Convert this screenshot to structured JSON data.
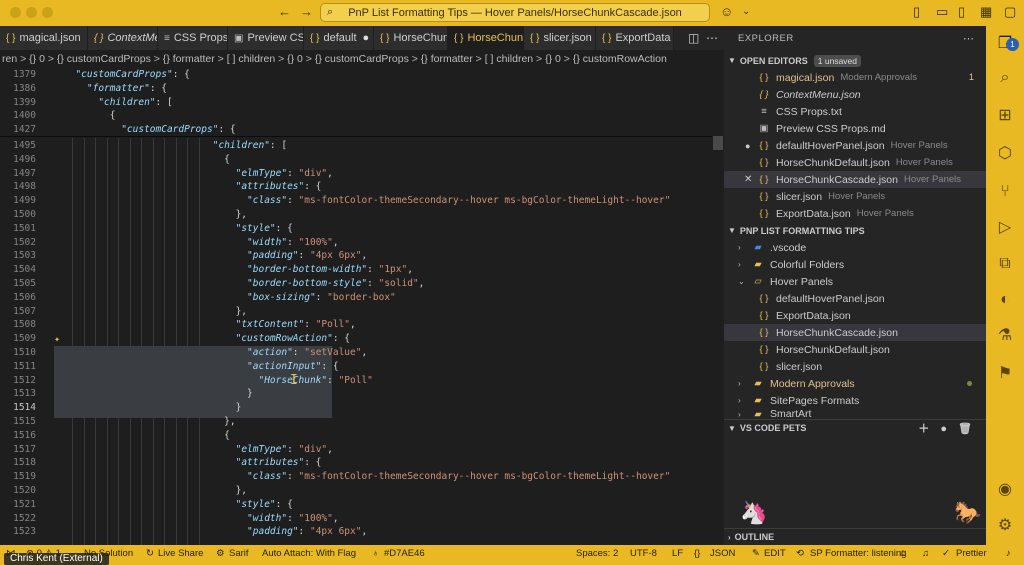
{
  "window": {
    "title": "PnP List Formatting Tips — Hover Panels/HorseChunkCascade.json"
  },
  "tabs": [
    {
      "label": "magical.json",
      "icon": "json-icon"
    },
    {
      "label": "ContextMe",
      "icon": "json-icon"
    },
    {
      "label": "CSS Props.",
      "icon": "text-icon"
    },
    {
      "label": "Preview CS",
      "icon": "preview-icon"
    },
    {
      "label": "default",
      "icon": "json-icon"
    },
    {
      "label": "HorseChun",
      "icon": "json-icon"
    },
    {
      "label": "HorseChun",
      "icon": "json-icon"
    },
    {
      "label": "slicer.json",
      "icon": "json-icon"
    },
    {
      "label": "ExportData",
      "icon": "json-icon"
    }
  ],
  "breadcrumb": "ren > {} 0 > {} customCardProps > {} formatter > [ ] children > {} 0 > {} customCardProps > {} formatter > [ ] children > {} 0 > {} customRowAction",
  "editor": {
    "lines": [
      {
        "n": "1379",
        "code": "  \"customCardProps\": {"
      },
      {
        "n": "1386",
        "code": "    \"formatter\": {"
      },
      {
        "n": "1399",
        "code": "      \"children\": ["
      },
      {
        "n": "1400",
        "code": "        {"
      },
      {
        "n": "1427",
        "code": "          \"customCardProps\": {"
      },
      {
        "n": "1495",
        "code": "                          \"children\": ["
      },
      {
        "n": "1496",
        "code": "                            {"
      },
      {
        "n": "1497",
        "code": "                              \"elmType\": \"div\","
      },
      {
        "n": "1498",
        "code": "                              \"attributes\": {"
      },
      {
        "n": "1499",
        "code": "                                \"class\": \"ms-fontColor-themeSecondary--hover ms-bgColor-themeLight--hover\""
      },
      {
        "n": "1500",
        "code": "                              },"
      },
      {
        "n": "1501",
        "code": "                              \"style\": {"
      },
      {
        "n": "1502",
        "code": "                                \"width\": \"100%\","
      },
      {
        "n": "1503",
        "code": "                                \"padding\": \"4px 6px\","
      },
      {
        "n": "1504",
        "code": "                                \"border-bottom-width\": \"1px\","
      },
      {
        "n": "1505",
        "code": "                                \"border-bottom-style\": \"solid\","
      },
      {
        "n": "1506",
        "code": "                                \"box-sizing\": \"border-box\""
      },
      {
        "n": "1507",
        "code": "                              },"
      },
      {
        "n": "1508",
        "code": "                              \"txtContent\": \"Poll\","
      },
      {
        "n": "1509",
        "code": "                              \"customRowAction\": {"
      },
      {
        "n": "1510",
        "code": "                                \"action\": \"setValue\","
      },
      {
        "n": "1511",
        "code": "                                \"actionInput\": {"
      },
      {
        "n": "1512",
        "code": "                                  \"HorseChunk\": \"Poll\""
      },
      {
        "n": "1513",
        "code": "                                }"
      },
      {
        "n": "1514",
        "code": "                              }"
      },
      {
        "n": "1515",
        "code": "                            },"
      },
      {
        "n": "1516",
        "code": "                            {"
      },
      {
        "n": "1517",
        "code": "                              \"elmType\": \"div\","
      },
      {
        "n": "1518",
        "code": "                              \"attributes\": {"
      },
      {
        "n": "1519",
        "code": "                                \"class\": \"ms-fontColor-themeSecondary--hover ms-bgColor-themeLight--hover\""
      },
      {
        "n": "1520",
        "code": "                              },"
      },
      {
        "n": "1521",
        "code": "                              \"style\": {"
      },
      {
        "n": "1522",
        "code": "                                \"width\": \"100%\","
      },
      {
        "n": "1523",
        "code": "                                \"padding\": \"4px 6px\","
      }
    ]
  },
  "explorer": {
    "header": "EXPLORER",
    "open_editors": {
      "title": "OPEN EDITORS",
      "badge": "1 unsaved",
      "items": [
        {
          "name": "magical.json",
          "desc": "Modern Approvals",
          "count": "1",
          "icon": "json-icon"
        },
        {
          "name": "ContextMenu.json",
          "desc": "",
          "icon": "json-icon"
        },
        {
          "name": "CSS Props.txt",
          "desc": "",
          "icon": "text-icon"
        },
        {
          "name": "Preview CSS Props.md",
          "desc": "",
          "icon": "preview-icon"
        },
        {
          "name": "defaultHoverPanel.json",
          "desc": "Hover Panels",
          "icon": "json-icon"
        },
        {
          "name": "HorseChunkDefault.json",
          "desc": "Hover Panels",
          "icon": "json-icon"
        },
        {
          "name": "HorseChunkCascade.json",
          "desc": "Hover Panels",
          "icon": "json-icon"
        },
        {
          "name": "slicer.json",
          "desc": "Hover Panels",
          "icon": "json-icon"
        },
        {
          "name": "ExportData.json",
          "desc": "Hover Panels",
          "icon": "json-icon"
        }
      ]
    },
    "project": {
      "title": "PNP LIST FORMATTING TIPS",
      "items": [
        {
          "name": ".vscode",
          "type": "folder"
        },
        {
          "name": "Colorful Folders",
          "type": "folder"
        },
        {
          "name": "Hover Panels",
          "type": "folder-open"
        },
        {
          "name": "defaultHoverPanel.json",
          "type": "file"
        },
        {
          "name": "ExportData.json",
          "type": "file"
        },
        {
          "name": "HorseChunkCascade.json",
          "type": "file"
        },
        {
          "name": "HorseChunkDefault.json",
          "type": "file"
        },
        {
          "name": "slicer.json",
          "type": "file"
        },
        {
          "name": "Modern Approvals",
          "type": "folder"
        },
        {
          "name": "SitePages Formats",
          "type": "folder"
        },
        {
          "name": "SmartArt",
          "type": "folder"
        }
      ]
    },
    "pets_title": "VS CODE PETS",
    "outline_title": "OUTLINE"
  },
  "statusbar": {
    "errors": "⊗ 0 ⚠ 1",
    "solution": "No Solution",
    "live_share": "Live Share",
    "sarif": "Sarif",
    "auto_attach": "Auto Attach: With Flag",
    "color": "#D7AE46",
    "spaces": "Spaces: 2",
    "encoding": "UTF-8",
    "eol": "LF",
    "language": "JSON",
    "edit": "EDIT",
    "formatter": "SP Formatter: listening",
    "prettier": "Prettier"
  },
  "overlay": {
    "name": "Chris Kent (External)"
  },
  "colors": {
    "accent": "#e8b923",
    "editor_bg": "#1e1e1e",
    "sidebar_bg": "#252526",
    "key": "#9cdcfe",
    "string": "#ce9178"
  }
}
